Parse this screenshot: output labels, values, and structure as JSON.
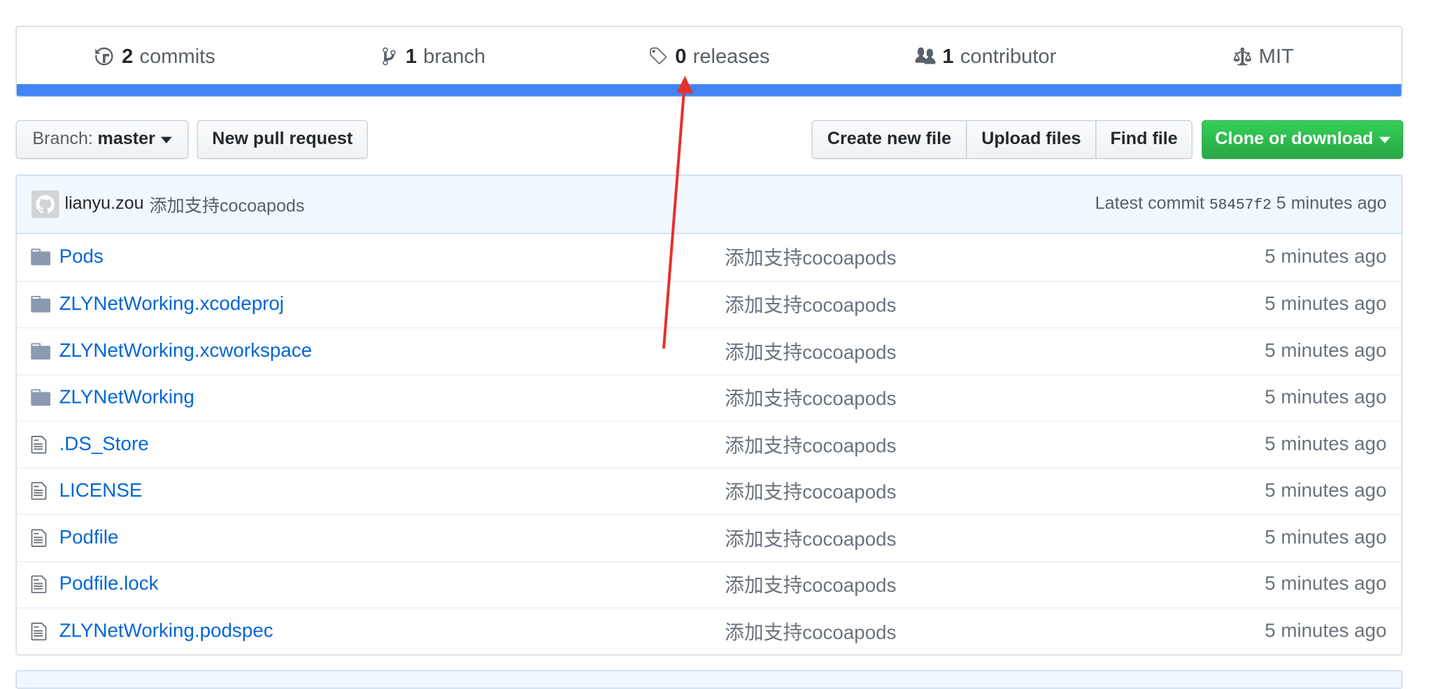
{
  "summary": {
    "commits": {
      "count": "2",
      "label": "commits"
    },
    "branches": {
      "count": "1",
      "label": "branch"
    },
    "releases": {
      "count": "0",
      "label": "releases"
    },
    "contributors": {
      "count": "1",
      "label": "contributor"
    },
    "license": "MIT",
    "language_bar_color": "#4184f3"
  },
  "toolbar": {
    "branch_prefix": "Branch:",
    "branch_name": "master",
    "new_pull_request": "New pull request",
    "create_new_file": "Create new file",
    "upload_files": "Upload files",
    "find_file": "Find file",
    "clone_or_download": "Clone or download"
  },
  "commit": {
    "author": "lianyu.zou",
    "message": "添加支持cocoapods",
    "latest_label": "Latest commit",
    "sha": "58457f2",
    "age": "5 minutes ago"
  },
  "files": [
    {
      "type": "dir",
      "name": "Pods",
      "message": "添加支持cocoapods",
      "age": "5 minutes ago"
    },
    {
      "type": "dir",
      "name": "ZLYNetWorking.xcodeproj",
      "message": "添加支持cocoapods",
      "age": "5 minutes ago"
    },
    {
      "type": "dir",
      "name": "ZLYNetWorking.xcworkspace",
      "message": "添加支持cocoapods",
      "age": "5 minutes ago"
    },
    {
      "type": "dir",
      "name": "ZLYNetWorking",
      "message": "添加支持cocoapods",
      "age": "5 minutes ago"
    },
    {
      "type": "file",
      "name": ".DS_Store",
      "message": "添加支持cocoapods",
      "age": "5 minutes ago"
    },
    {
      "type": "file",
      "name": "LICENSE",
      "message": "添加支持cocoapods",
      "age": "5 minutes ago"
    },
    {
      "type": "file",
      "name": "Podfile",
      "message": "添加支持cocoapods",
      "age": "5 minutes ago"
    },
    {
      "type": "file",
      "name": "Podfile.lock",
      "message": "添加支持cocoapods",
      "age": "5 minutes ago"
    },
    {
      "type": "file",
      "name": "ZLYNetWorking.podspec",
      "message": "添加支持cocoapods",
      "age": "5 minutes ago"
    }
  ],
  "colors": {
    "link": "#0366d6",
    "clone_button": "#28a745",
    "annotation_arrow": "#e8302a"
  }
}
